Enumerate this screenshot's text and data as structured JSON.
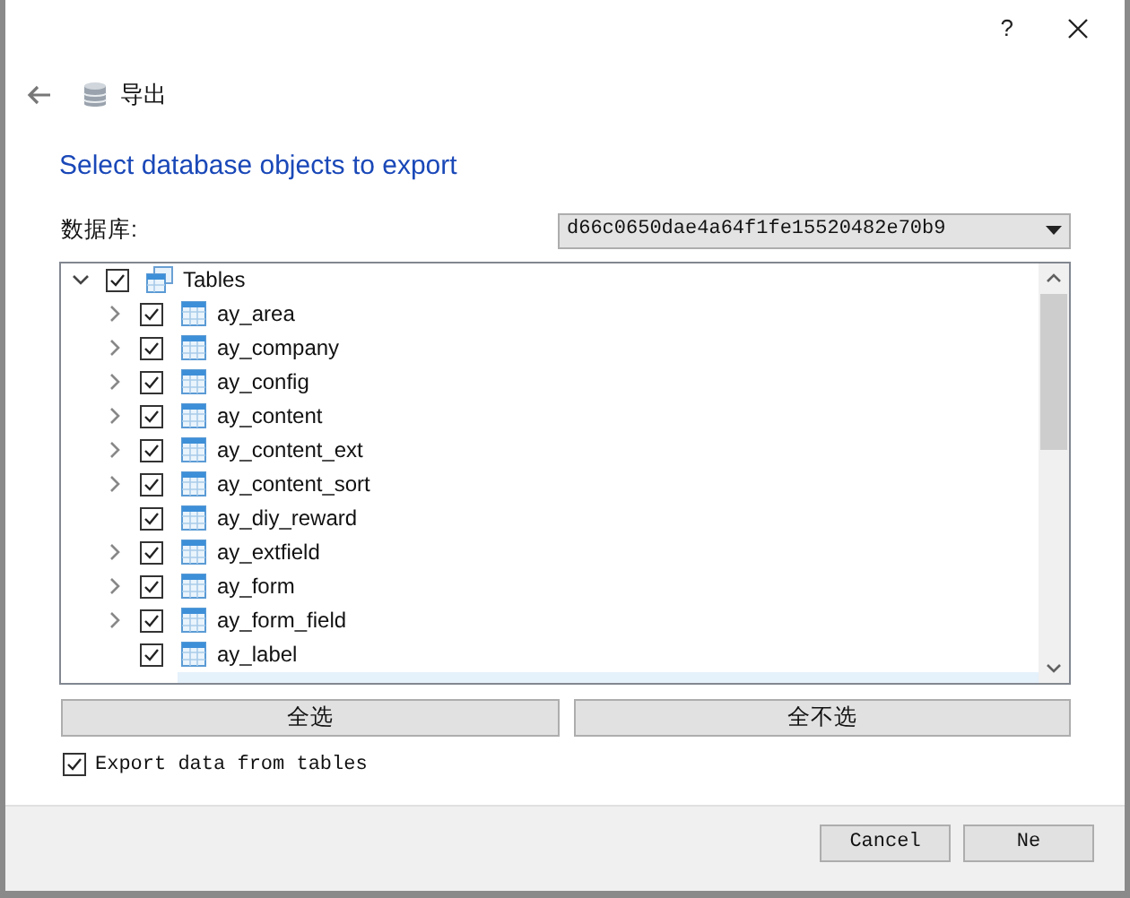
{
  "window": {
    "help": "?",
    "title": "导出"
  },
  "heading": "Select database objects to export",
  "database": {
    "label": "数据库:",
    "value": "d66c0650dae4a64f1fe15520482e70b9"
  },
  "tree": [
    {
      "label": "Tables",
      "checked": true,
      "expanded": true,
      "has_children": true,
      "children": [
        {
          "label": "ay_area",
          "checked": true,
          "has_children": true
        },
        {
          "label": "ay_company",
          "checked": true,
          "has_children": true
        },
        {
          "label": "ay_config",
          "checked": true,
          "has_children": true
        },
        {
          "label": "ay_content",
          "checked": true,
          "has_children": true
        },
        {
          "label": "ay_content_ext",
          "checked": true,
          "has_children": true
        },
        {
          "label": "ay_content_sort",
          "checked": true,
          "has_children": true
        },
        {
          "label": "ay_diy_reward",
          "checked": true,
          "has_children": false
        },
        {
          "label": "ay_extfield",
          "checked": true,
          "has_children": true
        },
        {
          "label": "ay_form",
          "checked": true,
          "has_children": true
        },
        {
          "label": "ay_form_field",
          "checked": true,
          "has_children": true
        },
        {
          "label": "ay_label",
          "checked": true,
          "has_children": false
        }
      ]
    }
  ],
  "select_buttons": [
    "全选",
    "全不选"
  ],
  "export_data": {
    "label": "Export data from tables",
    "checked": true
  },
  "footer_buttons": [
    "Cancel",
    "Ne"
  ]
}
